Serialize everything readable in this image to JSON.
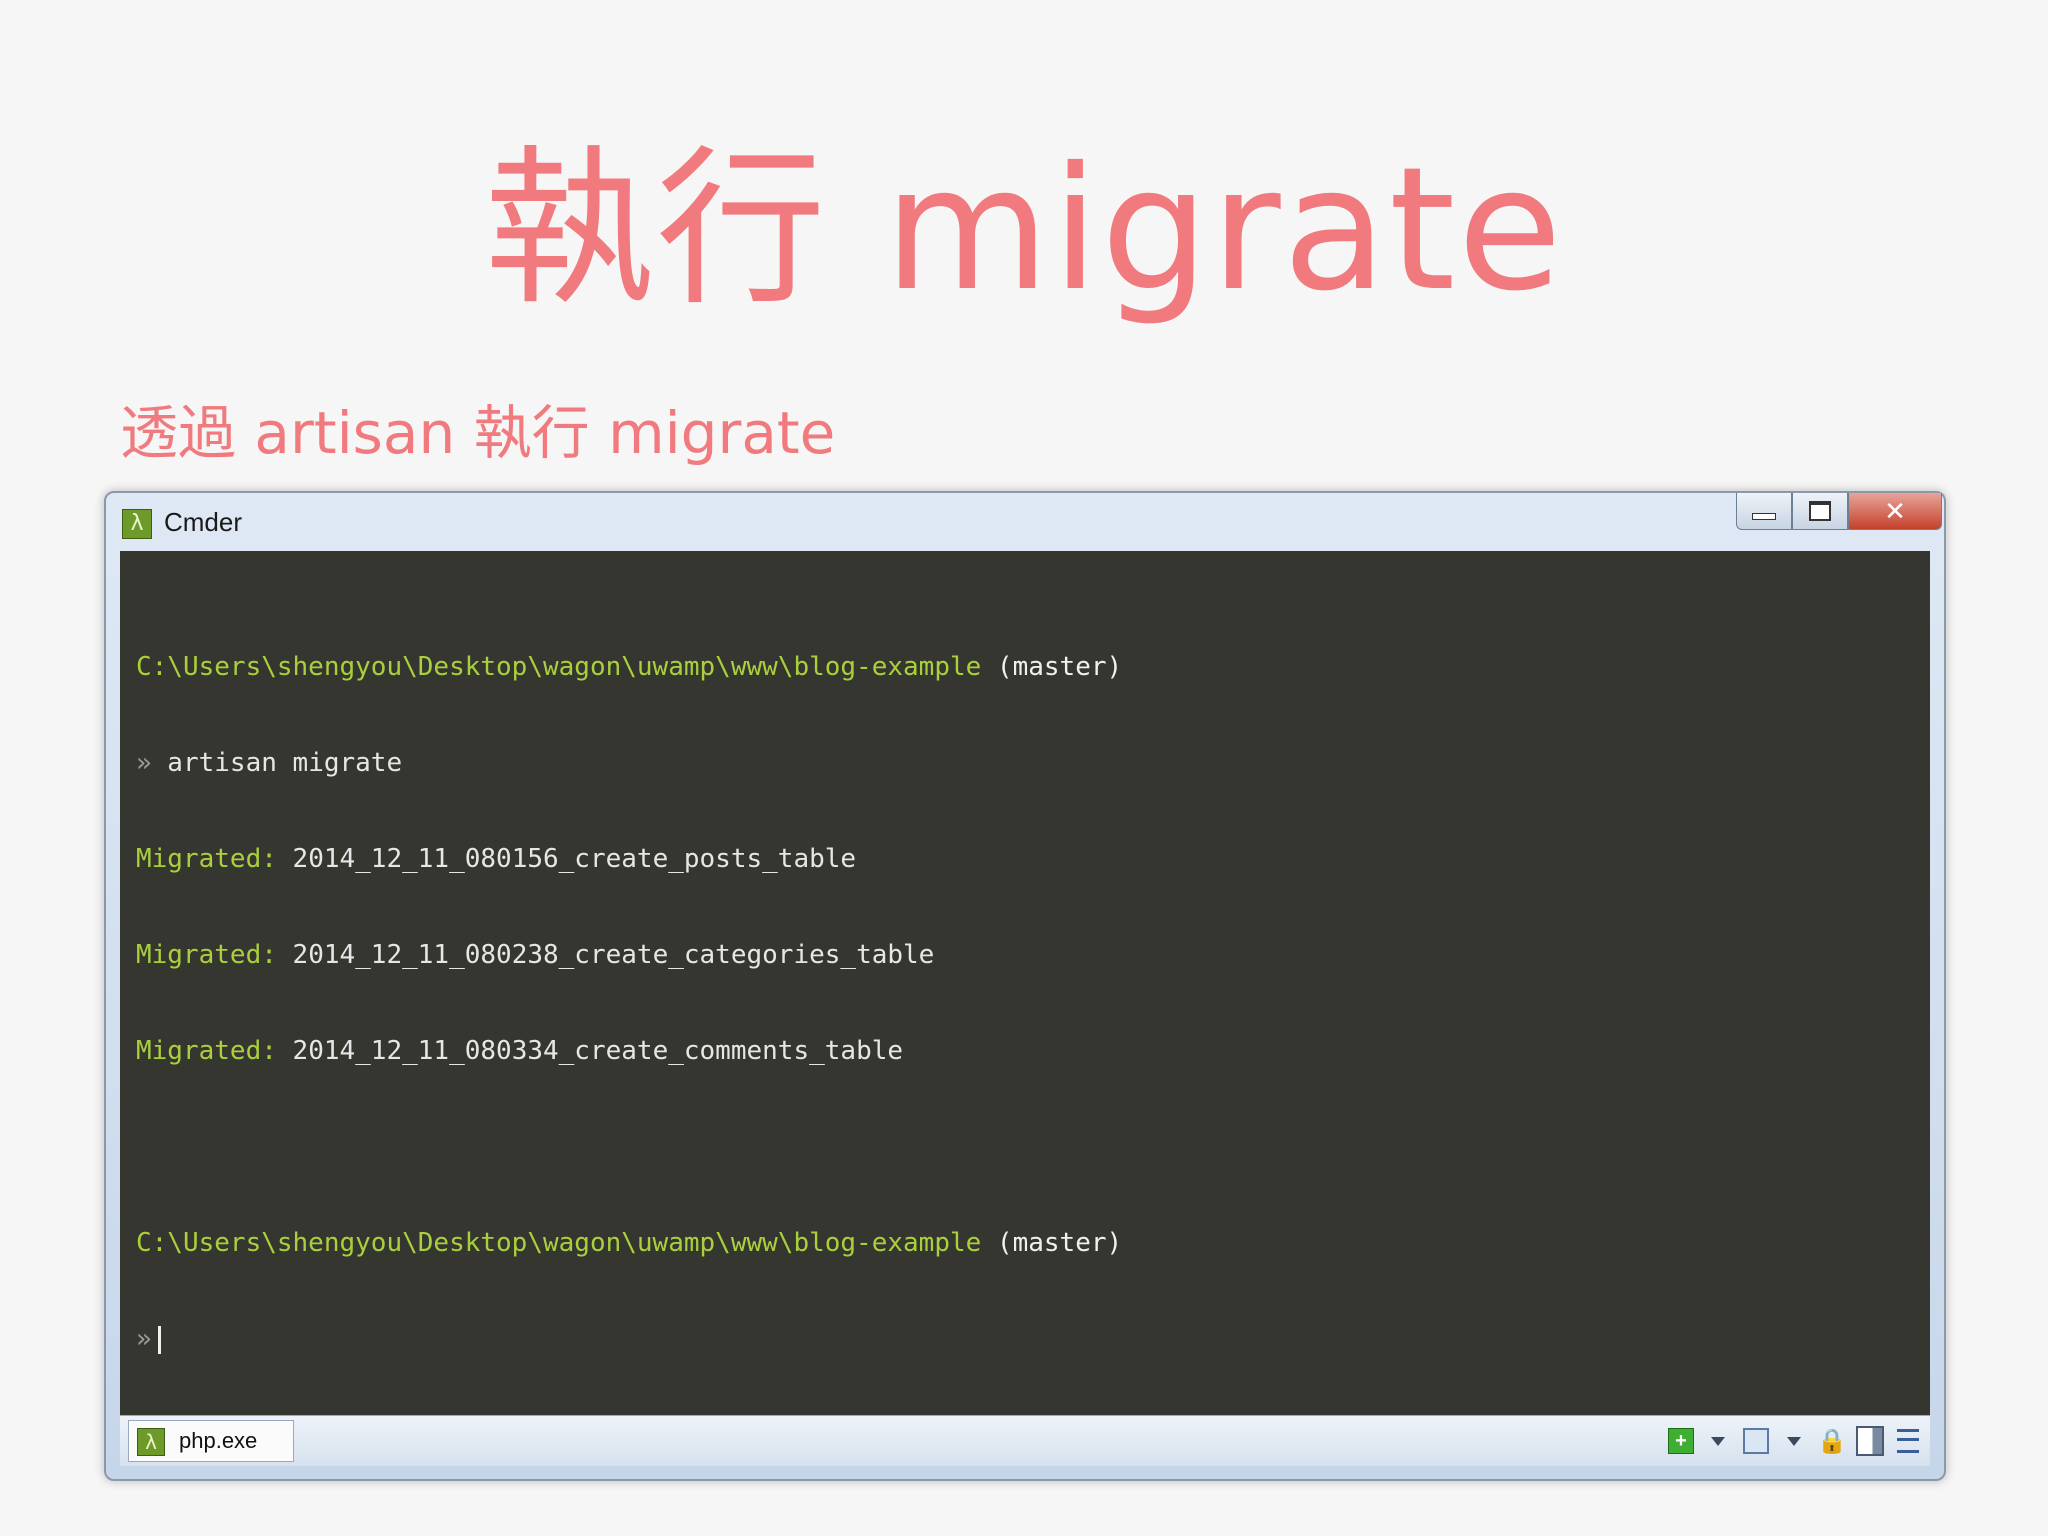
{
  "slide": {
    "title": "執行 migrate",
    "subtitle": "透過 artisan 執行 migrate"
  },
  "window": {
    "title": "Cmder",
    "app_icon": "lambda-icon",
    "buttons": {
      "minimize": "minimize-icon",
      "maximize": "maximize-icon",
      "close": "✕"
    }
  },
  "terminal": {
    "lines": [
      {
        "path": "C:\\Users\\shengyou\\Desktop\\wagon\\uwamp\\www\\blog-example",
        "branch": " (master)"
      },
      {
        "prompt": "»",
        "command": " artisan migrate"
      },
      {
        "label": "Migrated:",
        "text": " 2014_12_11_080156_create_posts_table"
      },
      {
        "label": "Migrated:",
        "text": " 2014_12_11_080238_create_categories_table"
      },
      {
        "label": "Migrated:",
        "text": " 2014_12_11_080334_create_comments_table"
      },
      {
        "path": "C:\\Users\\shengyou\\Desktop\\wagon\\uwamp\\www\\blog-example",
        "branch": " (master)"
      },
      {
        "prompt": "»"
      }
    ]
  },
  "statusbar": {
    "tab_label": "php.exe",
    "tab_icon": "lambda-icon",
    "tools": [
      "add-console-icon",
      "dropdown-icon",
      "pane-icon",
      "dropdown-icon",
      "lock-icon",
      "split-view-icon",
      "menu-icon"
    ]
  },
  "colors": {
    "accent": "#f07a7d",
    "terminal_bg": "#363630",
    "path": "#a9d03b"
  }
}
